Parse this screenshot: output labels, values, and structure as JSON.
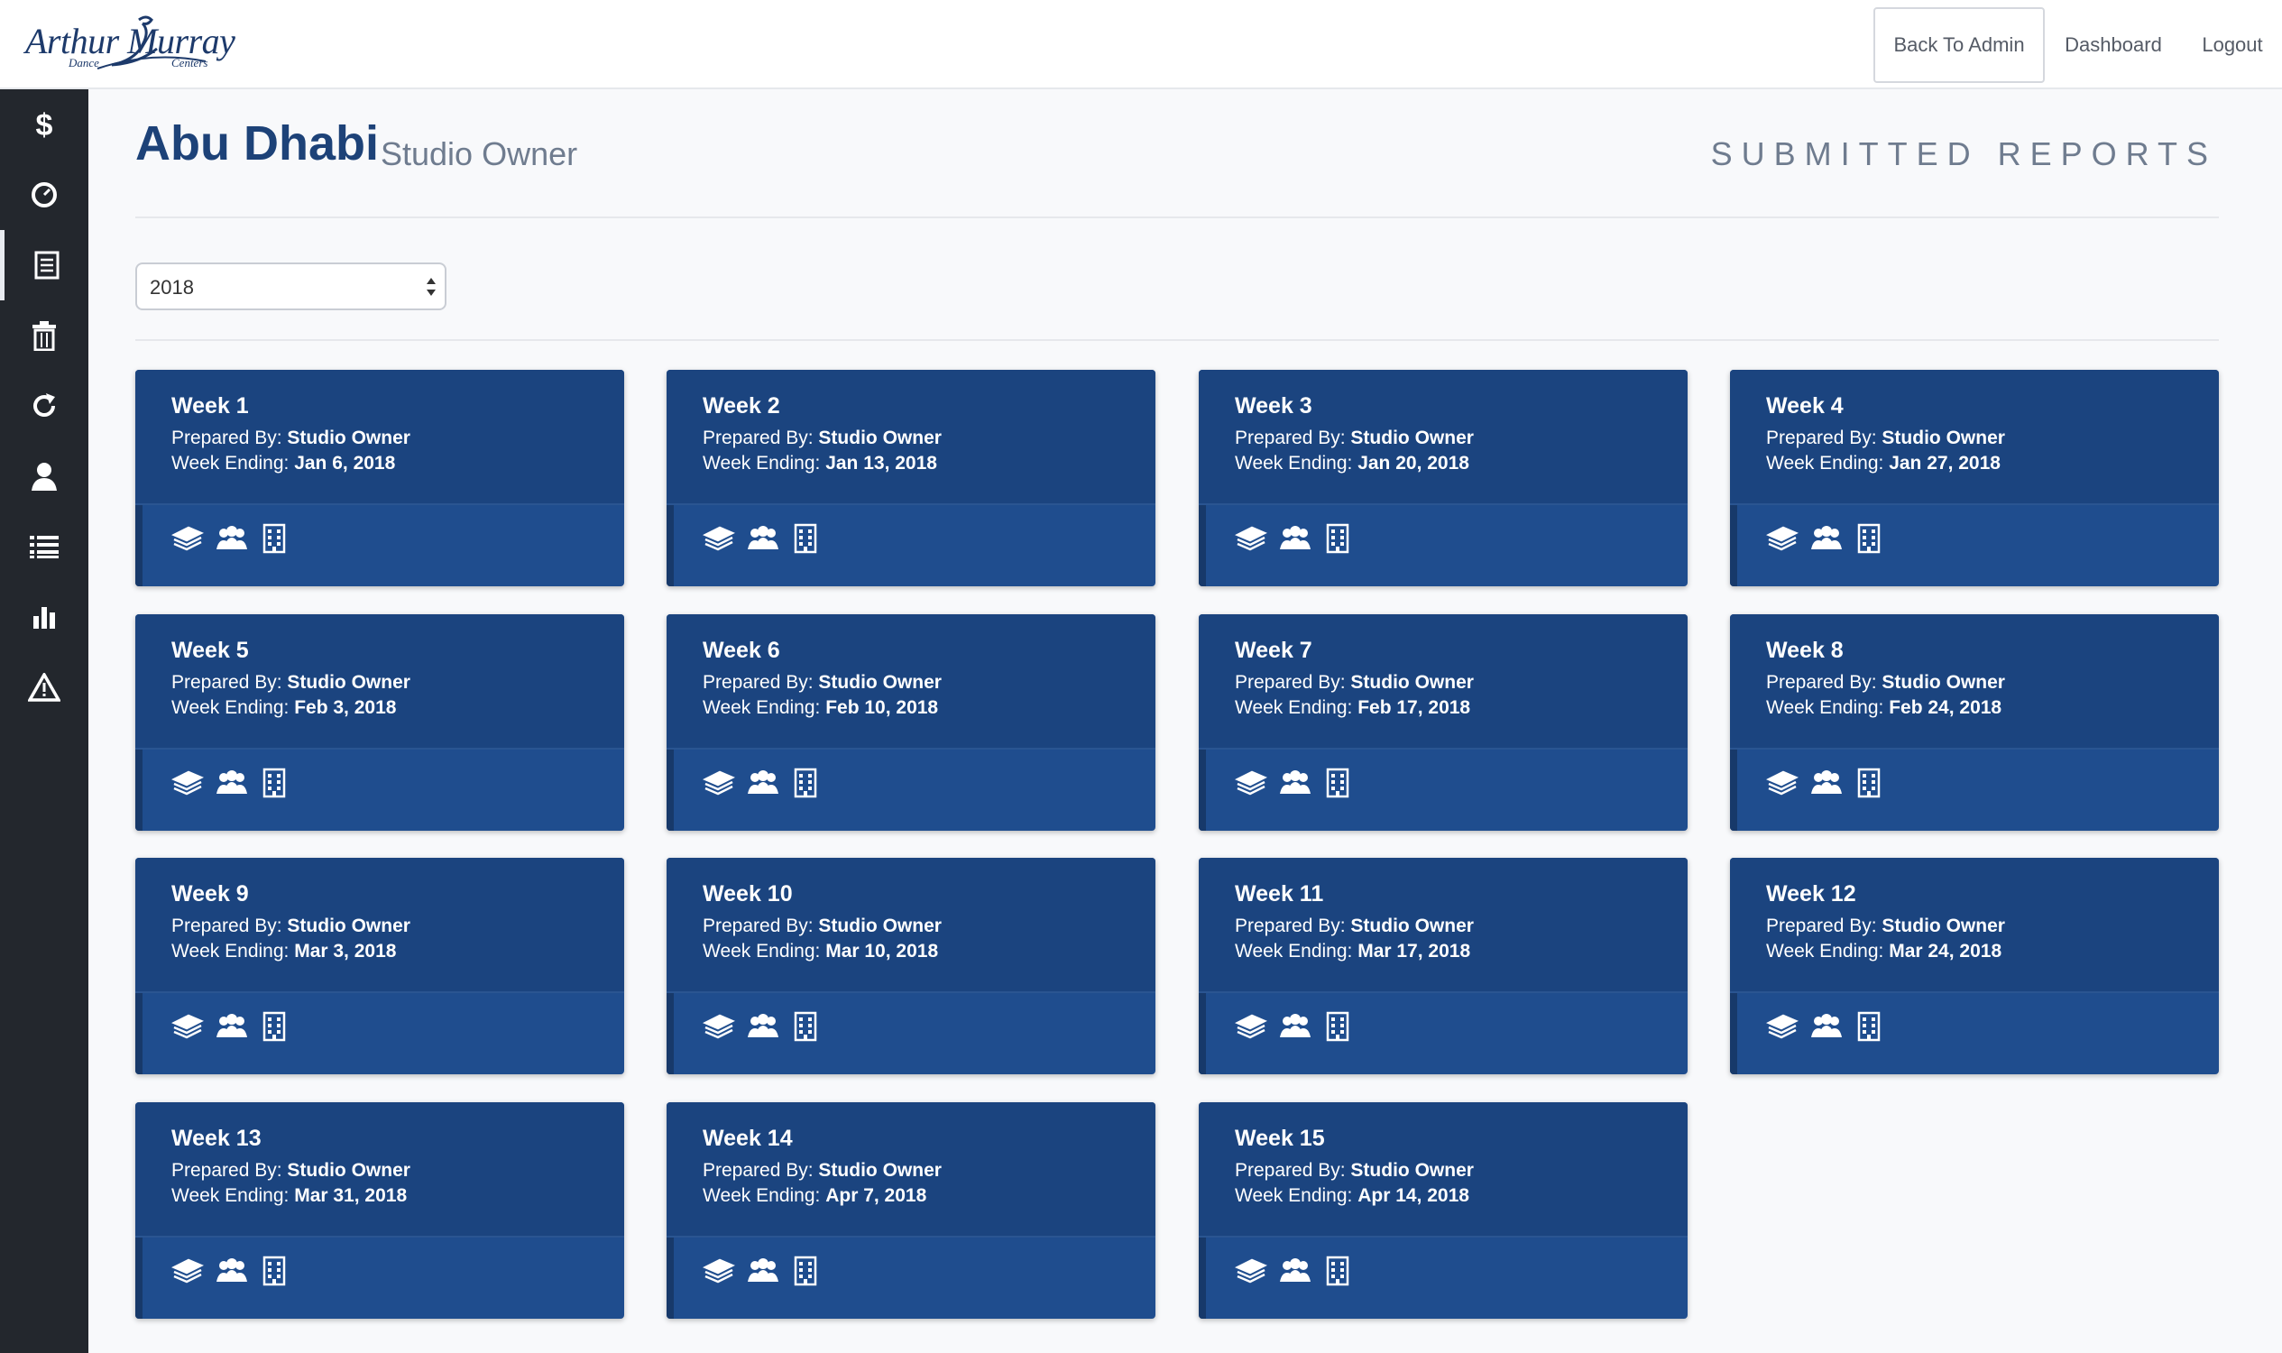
{
  "brand": {
    "name": "Arthur Murray",
    "sub_left": "Dance",
    "sub_right": "Centers"
  },
  "nav": {
    "back_to_admin": "Back To Admin",
    "dashboard": "Dashboard",
    "logout": "Logout"
  },
  "sidebar": {
    "items": [
      {
        "icon": "dollar-icon"
      },
      {
        "icon": "speedometer-icon"
      },
      {
        "icon": "document-icon",
        "active": true
      },
      {
        "icon": "trash-icon"
      },
      {
        "icon": "refresh-icon"
      },
      {
        "icon": "user-icon"
      },
      {
        "icon": "list-icon"
      },
      {
        "icon": "bar-chart-icon"
      },
      {
        "icon": "warning-icon"
      }
    ]
  },
  "header": {
    "title": "Abu Dhabi",
    "subtitle": "Studio Owner",
    "section": "SUBMITTED REPORTS"
  },
  "filter": {
    "year": "2018"
  },
  "labels": {
    "prepared_by": "Prepared By:",
    "week_ending": "Week Ending:"
  },
  "reports": [
    {
      "title": "Week 1",
      "prepared_by": "Studio Owner",
      "week_ending": "Jan 6, 2018"
    },
    {
      "title": "Week 2",
      "prepared_by": "Studio Owner",
      "week_ending": "Jan 13, 2018"
    },
    {
      "title": "Week 3",
      "prepared_by": "Studio Owner",
      "week_ending": "Jan 20, 2018"
    },
    {
      "title": "Week 4",
      "prepared_by": "Studio Owner",
      "week_ending": "Jan 27, 2018"
    },
    {
      "title": "Week 5",
      "prepared_by": "Studio Owner",
      "week_ending": "Feb 3, 2018"
    },
    {
      "title": "Week 6",
      "prepared_by": "Studio Owner",
      "week_ending": "Feb 10, 2018"
    },
    {
      "title": "Week 7",
      "prepared_by": "Studio Owner",
      "week_ending": "Feb 17, 2018"
    },
    {
      "title": "Week 8",
      "prepared_by": "Studio Owner",
      "week_ending": "Feb 24, 2018"
    },
    {
      "title": "Week 9",
      "prepared_by": "Studio Owner",
      "week_ending": "Mar 3, 2018"
    },
    {
      "title": "Week 10",
      "prepared_by": "Studio Owner",
      "week_ending": "Mar 10, 2018"
    },
    {
      "title": "Week 11",
      "prepared_by": "Studio Owner",
      "week_ending": "Mar 17, 2018"
    },
    {
      "title": "Week 12",
      "prepared_by": "Studio Owner",
      "week_ending": "Mar 24, 2018"
    },
    {
      "title": "Week 13",
      "prepared_by": "Studio Owner",
      "week_ending": "Mar 31, 2018"
    },
    {
      "title": "Week 14",
      "prepared_by": "Studio Owner",
      "week_ending": "Apr 7, 2018"
    },
    {
      "title": "Week 15",
      "prepared_by": "Studio Owner",
      "week_ending": "Apr 14, 2018"
    }
  ],
  "card_icons": [
    "money-stack-icon",
    "group-icon",
    "building-icon"
  ],
  "colors": {
    "sidebar": "#23272d",
    "card": "#1f4d8e",
    "card_top": "#1b447f",
    "title": "#1d4278"
  }
}
